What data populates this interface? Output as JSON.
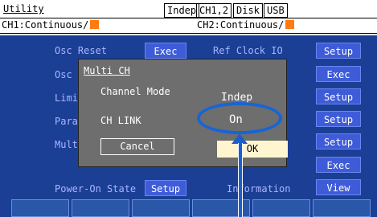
{
  "header": {
    "title": "Utility",
    "chips": [
      "Indep",
      "CH1,2",
      "Disk",
      "USB"
    ],
    "ch1_mode": "CH1:Continuous/",
    "ch2_mode": "CH2:Continuous/"
  },
  "panel": {
    "osc_reset_label": "Osc Reset",
    "osc_reset_button": "Exec",
    "osc_label": "Osc",
    "limit_label": "Limi",
    "param_label": "Para",
    "mult_label": "Mult",
    "ref_clock_label": "Ref Clock IO",
    "right_buttons": [
      "Setup",
      "Exec",
      "Setup",
      "Setup",
      "Setup",
      "Exec",
      "View"
    ],
    "power_on_label": "Power-On State",
    "power_on_button": "Setup",
    "information_label": "Information"
  },
  "dialog": {
    "title": "Multi CH",
    "channel_mode_label": "Channel Mode",
    "channel_mode_value": "Indep",
    "ch_link_label": "CH LINK",
    "ch_link_value": "On",
    "cancel_label": "Cancel",
    "ok_label": "OK"
  },
  "colors": {
    "background": "#1a3f95",
    "button": "#3f5cd8",
    "dialog": "#6e6e6e",
    "highlight": "#fff6d0",
    "annotation": "#1565d6",
    "status_orange": "#ff7a10"
  }
}
